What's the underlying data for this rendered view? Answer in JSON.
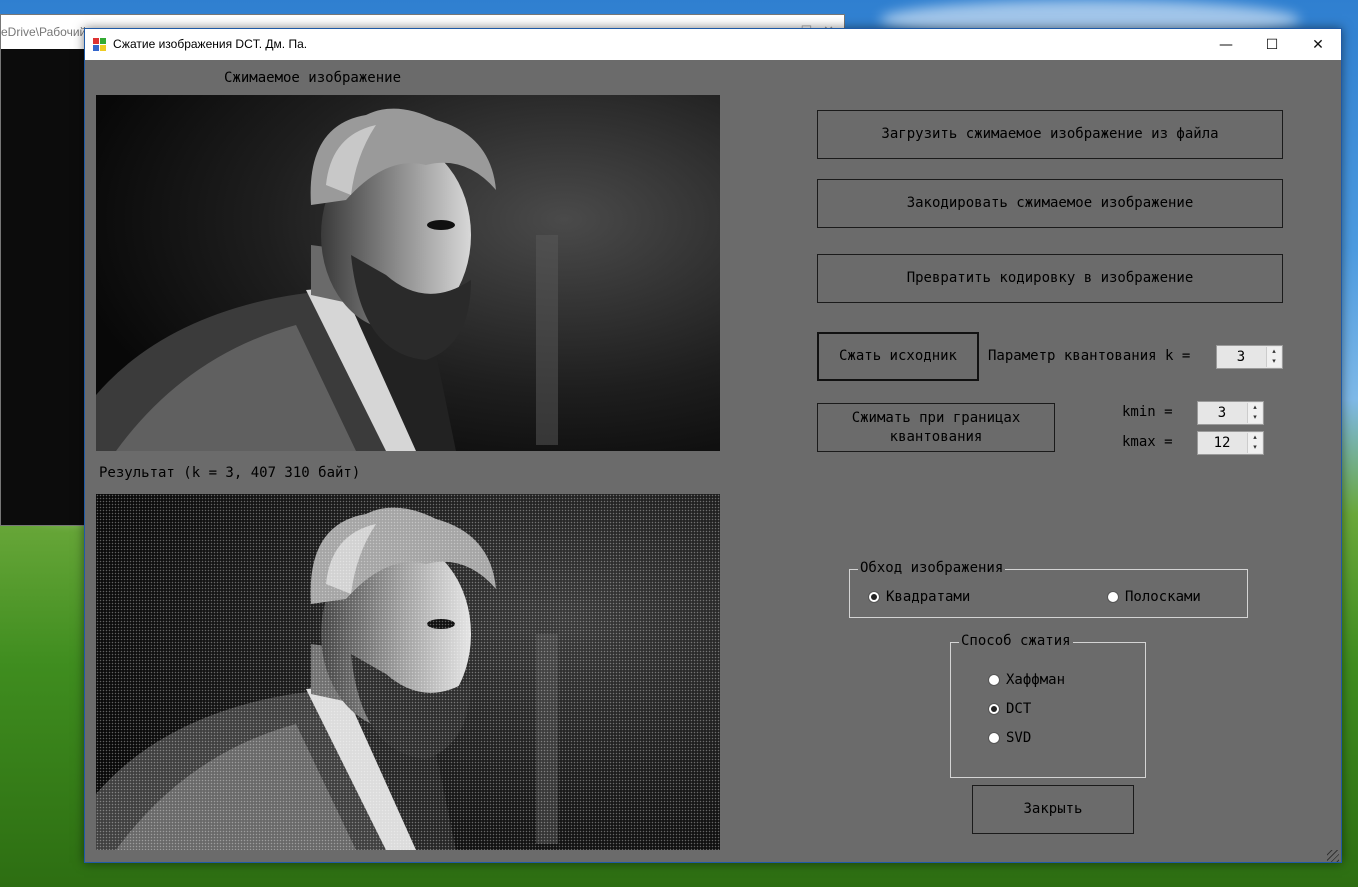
{
  "background_window": {
    "title": "eDrive\\Рабочий"
  },
  "window": {
    "title": "Сжатие изображения DCT. Дм. Па.",
    "minimize_glyph": "—",
    "maximize_glyph": "☐",
    "close_glyph": "✕"
  },
  "source_panel": {
    "label": "Сжимаемое изображение"
  },
  "result_panel": {
    "label": "Результат (k = 3, 407 310 байт)"
  },
  "buttons": {
    "load": "Загрузить сжимаемое изображение из файла",
    "encode": "Закодировать сжимаемое изображение",
    "decode": "Превратить кодировку в изображение",
    "compress": "Сжать исходник",
    "compress_range": "Сжимать при границах квантования",
    "close": "Закрыть"
  },
  "quantization": {
    "label": "Параметр квантования k =",
    "value": "3"
  },
  "bounds": {
    "kmin_label": "kmin =",
    "kmin_value": "3",
    "kmax_label": "kmax =",
    "kmax_value": "12"
  },
  "traversal_group": {
    "caption": "Обход изображения",
    "options": [
      {
        "label": "Квадратами",
        "selected": true
      },
      {
        "label": "Полосками",
        "selected": false
      }
    ]
  },
  "method_group": {
    "caption": "Способ сжатия",
    "options": [
      {
        "label": "Хаффман",
        "selected": false
      },
      {
        "label": "DCT",
        "selected": true
      },
      {
        "label": "SVD",
        "selected": false
      }
    ]
  },
  "spinner_arrows": {
    "up": "▴",
    "down": "▾"
  },
  "colors": {
    "form_bg": "#6b6b6b",
    "title_bar": "#ffffff",
    "window_border": "#1f5aa6"
  }
}
